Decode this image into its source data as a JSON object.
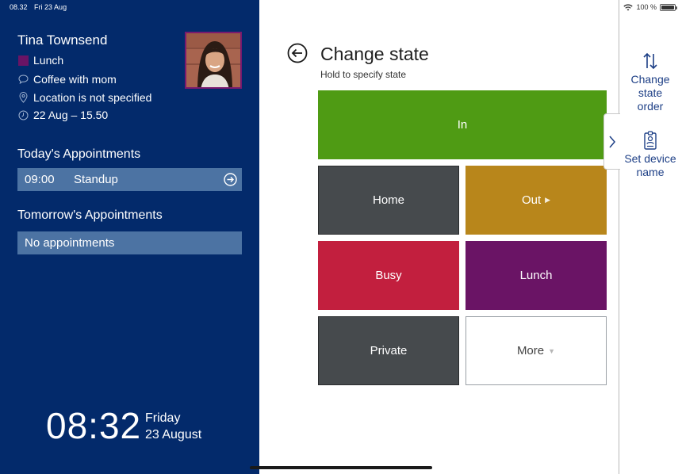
{
  "status_bar": {
    "time": "08.32",
    "date": "Fri 23 Aug",
    "battery": "100 %",
    "battery_level": 1.0
  },
  "person": {
    "name": "Tina Townsend",
    "state": "Lunch",
    "state_color": "#6a1465",
    "note": "Coffee with mom",
    "location": "Location is not specified",
    "until": "22 Aug – 15.50"
  },
  "today": {
    "title": "Today's Appointments",
    "items": [
      {
        "time": "09:00",
        "title": "Standup"
      }
    ]
  },
  "tomorrow": {
    "title": "Tomorrow's Appointments",
    "empty_label": "No appointments"
  },
  "clock": {
    "time": "08:32",
    "weekday": "Friday",
    "date": "23 August"
  },
  "main": {
    "title": "Change state",
    "subtitle": "Hold to specify state",
    "states": {
      "in": {
        "label": "In",
        "color": "#4f9b14"
      },
      "home": {
        "label": "Home",
        "color": "#464a4d"
      },
      "out": {
        "label": "Out",
        "color": "#b8861b"
      },
      "busy": {
        "label": "Busy",
        "color": "#c21f3e"
      },
      "lunch": {
        "label": "Lunch",
        "color": "#6a1465"
      },
      "private": {
        "label": "Private",
        "color": "#464a4d"
      },
      "more": {
        "label": "More"
      }
    }
  },
  "side": {
    "change_order": {
      "line1": "Change",
      "line2": "state",
      "line3": "order",
      "icon": "sort-arrows-icon"
    },
    "set_device": {
      "line1": "Set device",
      "line2": "name",
      "icon": "id-badge-icon"
    }
  }
}
